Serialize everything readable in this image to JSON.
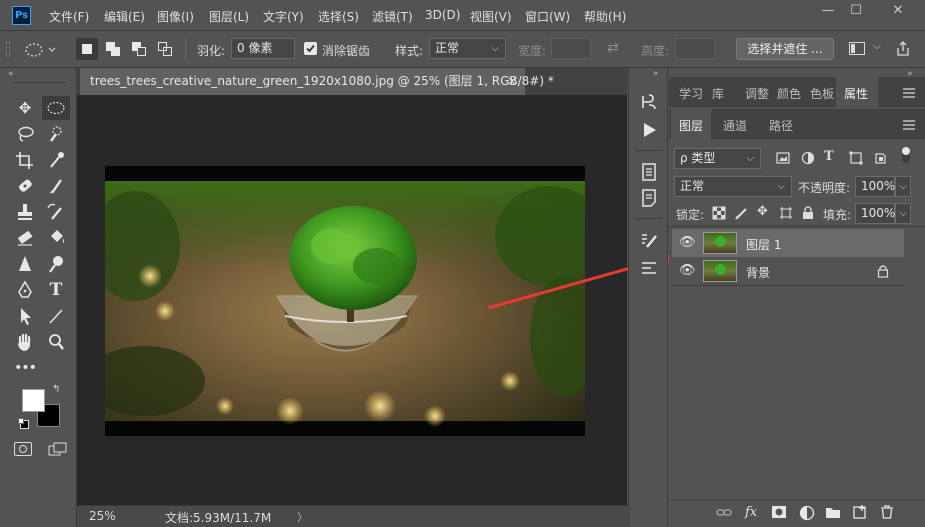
{
  "app": {
    "logo": "Ps"
  },
  "menu": [
    "文件(F)",
    "编辑(E)",
    "图像(I)",
    "图层(L)",
    "文字(Y)",
    "选择(S)",
    "滤镜(T)",
    "3D(D)",
    "视图(V)",
    "窗口(W)",
    "帮助(H)"
  ],
  "window_controls": {
    "minimize": "—",
    "maximize": "☐",
    "close": "✕"
  },
  "options": {
    "feather_label": "羽化:",
    "feather_value": "0 像素",
    "antialias_label": "消除锯齿",
    "antialias_checked": true,
    "style_label": "样式:",
    "style_value": "正常",
    "width_label": "宽度:",
    "height_label": "高度:",
    "swap_icon": "⇄",
    "select_mask_button": "选择并遮住 ..."
  },
  "document": {
    "tab_title": "trees_trees_creative_nature_green_1920x1080.jpg @ 25% (图层 1, RGB/8#) *",
    "close_icon": "×",
    "zoom": "25%",
    "doc_size": "文档:5.93M/11.7M",
    "status_arrow": "〉"
  },
  "panels": {
    "top_tabs": [
      "学习",
      "库",
      "调整",
      "颜色",
      "色板",
      "属性"
    ],
    "active_top_tab": "属性",
    "layer_tabs": [
      "图层",
      "通道",
      "路径"
    ],
    "active_layer_tab": "图层",
    "filter_label": "ρ 类型",
    "blend_mode": "正常",
    "opacity_label": "不透明度:",
    "opacity_value": "100%",
    "lock_label": "锁定:",
    "fill_label": "填充:",
    "fill_value": "100%",
    "layers": [
      {
        "name": "图层 1",
        "selected": true,
        "visible": true,
        "locked": false
      },
      {
        "name": "背景",
        "selected": false,
        "visible": true,
        "locked": true
      }
    ],
    "bottom_icons": [
      "link-icon",
      "fx-icon",
      "mask-icon",
      "adjustment-icon",
      "group-icon",
      "new-layer-icon",
      "delete-icon"
    ]
  },
  "colors": {
    "accent_selected_layer": "#6a6a6a",
    "canvas_background": "#282828",
    "arrow_annotation": "#e63a32",
    "foreground_color": "#ffffff",
    "background_color": "#000000"
  }
}
